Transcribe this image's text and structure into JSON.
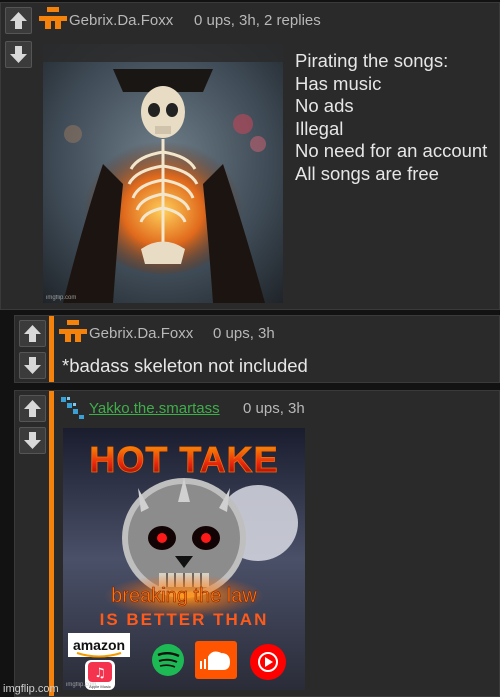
{
  "comments": [
    {
      "username": "Gebrix.Da.Foxx",
      "meta": "0 ups, 3h, 2 replies",
      "caption": [
        "Pirating the songs:",
        "Has music",
        "No ads",
        "Illegal",
        "No need for an account",
        "All songs are free"
      ],
      "image_watermark": "imgflip.com"
    },
    {
      "username": "Gebrix.Da.Foxx",
      "meta": "0 ups, 3h",
      "text": "*badass skeleton not included"
    },
    {
      "username": "Yakko.the.smartass",
      "meta": "0 ups, 3h",
      "image": {
        "title": "HOT TAKE",
        "subtitle": "breaking the law",
        "tagline": "IS BETTER THAN",
        "logos": [
          "amazon",
          "Apple Music",
          "Spotify",
          "SoundCloud",
          "YouTube Music"
        ],
        "amazon_label": "amazon",
        "apple_label": "Apple Music",
        "watermark": "imgflip.com"
      }
    }
  ],
  "footer": {
    "watermark": "imgflip.com"
  },
  "colors": {
    "accent": "#f5820b",
    "background": "#121212",
    "panel": "#2a2a2a",
    "link_green": "#3fae4a"
  }
}
